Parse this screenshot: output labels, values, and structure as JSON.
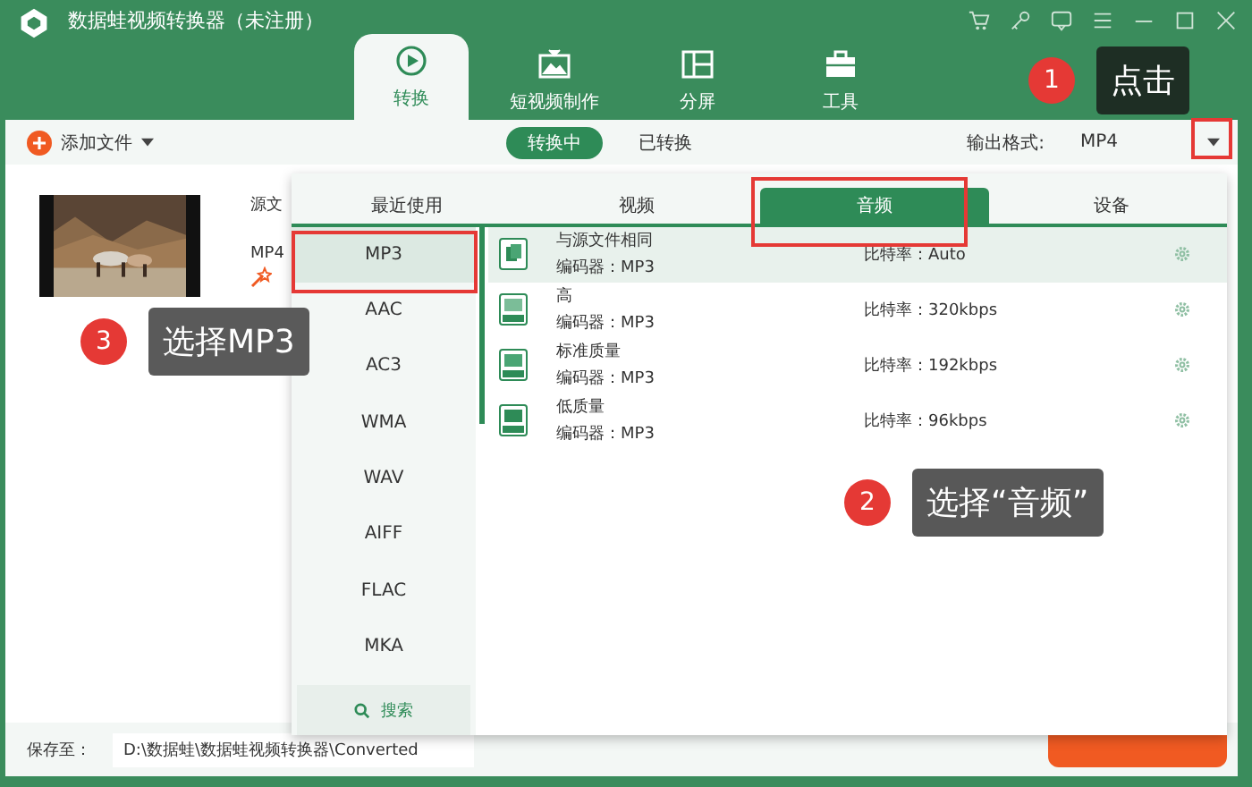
{
  "window": {
    "title": "数据蛙视频转换器（未注册）"
  },
  "nav_tabs": [
    {
      "label": "转换",
      "kind": "convert",
      "selected": true
    },
    {
      "label": "短视频制作",
      "kind": "video",
      "selected": false
    },
    {
      "label": "分屏",
      "kind": "split",
      "selected": false
    },
    {
      "label": "工具",
      "kind": "tools",
      "selected": false
    }
  ],
  "toolbar": {
    "add_file": "添加文件",
    "segments": [
      {
        "label": "转换中",
        "selected": true
      },
      {
        "label": "已转换",
        "selected": false
      }
    ],
    "output_label": "输出格式:",
    "output_value": "MP4"
  },
  "file_item": {
    "source_label": "源文",
    "format": "MP4"
  },
  "format_panel": {
    "tabs": [
      {
        "label": "最近使用",
        "selected": false
      },
      {
        "label": "视频",
        "selected": false
      },
      {
        "label": "音频",
        "selected": true
      },
      {
        "label": "设备",
        "selected": false
      }
    ],
    "formats": [
      {
        "label": "MP3",
        "selected": true
      },
      {
        "label": "AAC",
        "selected": false
      },
      {
        "label": "AC3",
        "selected": false
      },
      {
        "label": "WMA",
        "selected": false
      },
      {
        "label": "WAV",
        "selected": false
      },
      {
        "label": "AIFF",
        "selected": false
      },
      {
        "label": "FLAC",
        "selected": false
      },
      {
        "label": "MKA",
        "selected": false
      }
    ],
    "search": "搜索",
    "presets": [
      {
        "name": "与源文件相同",
        "codec": "编码器：MP3",
        "bitrate": "比特率：Auto",
        "kind": "same",
        "selected": true
      },
      {
        "name": "高",
        "codec": "编码器：MP3",
        "bitrate": "比特率：320kbps",
        "kind": "high",
        "selected": false
      },
      {
        "name": "标准质量",
        "codec": "编码器：MP3",
        "bitrate": "比特率：192kbps",
        "kind": "standard",
        "selected": false
      },
      {
        "name": "低质量",
        "codec": "编码器：MP3",
        "bitrate": "比特率：96kbps",
        "kind": "low",
        "selected": false
      }
    ]
  },
  "bottom_bar": {
    "save_label": "保存至：",
    "save_path": "D:\\数据蛙\\数据蛙视频转换器\\Converted"
  },
  "callouts": [
    {
      "number": "1",
      "text": "点击"
    },
    {
      "number": "2",
      "text": "选择“音频”"
    },
    {
      "number": "3",
      "text": "选择MP3"
    }
  ]
}
